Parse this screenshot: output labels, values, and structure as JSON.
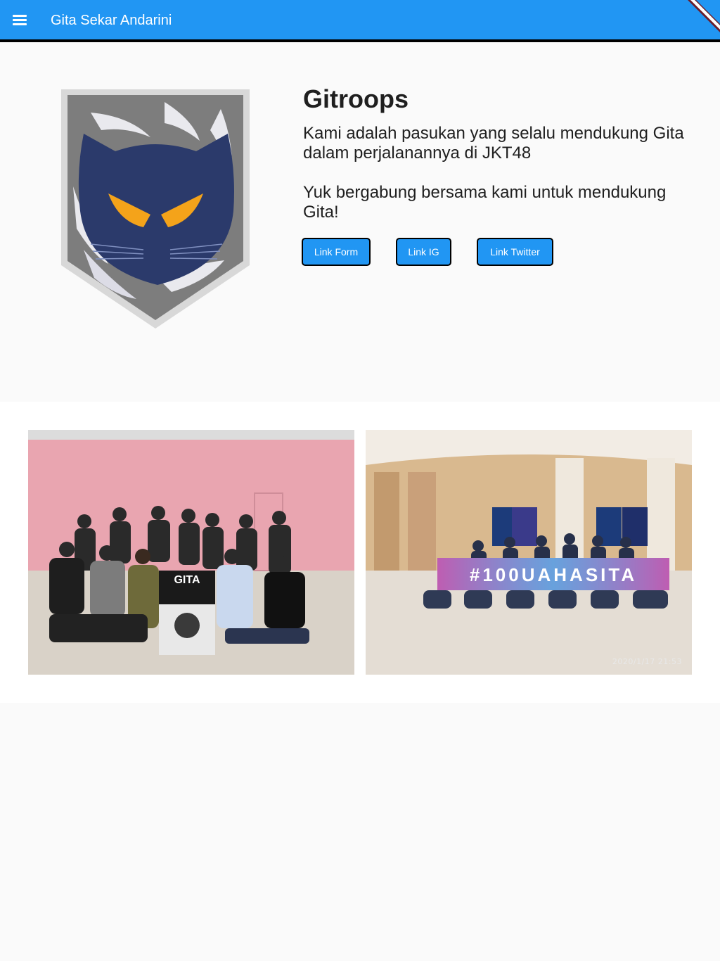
{
  "appbar": {
    "title": "Gita Sekar Andarini",
    "background": "#2196f3",
    "menu_icon": "menu-icon"
  },
  "hero": {
    "logo_icon": "cat-shield-logo",
    "title": "Gitroops",
    "description": "Kami adalah pasukan yang selalu mendukung Gita dalam perjalanannya di JKT48",
    "join_text": "Yuk bergabung bersama kami untuk mendukung Gita!",
    "buttons": [
      {
        "label": "Link Form"
      },
      {
        "label": "Link IG"
      },
      {
        "label": "Link Twitter"
      }
    ]
  },
  "gallery": {
    "photos": [
      {
        "name": "group-photo-pink-wall",
        "sign_text": "GITA"
      },
      {
        "name": "group-photo-theater",
        "banner_text": "#100UAHASITA",
        "timestamp": "2020/1/17  21:53"
      }
    ]
  },
  "colors": {
    "primary": "#2196f3",
    "background": "#fafafa",
    "logo_navy": "#2b3a6b",
    "logo_orange": "#f4a31a"
  }
}
